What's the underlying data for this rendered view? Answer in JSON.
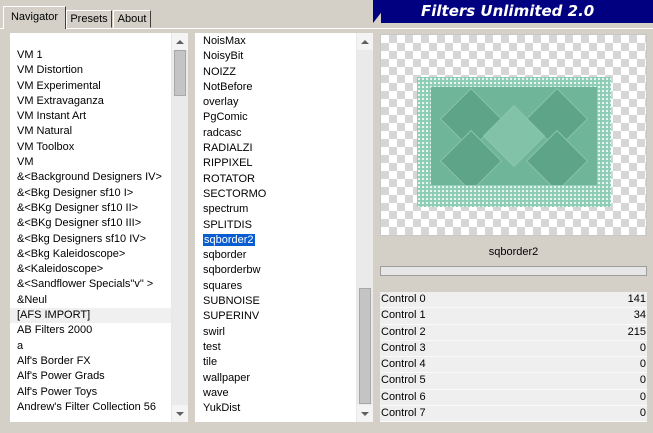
{
  "tabs": [
    {
      "label": "Navigator",
      "active": true
    },
    {
      "label": "Presets",
      "active": false
    },
    {
      "label": "About",
      "active": false
    }
  ],
  "banner": {
    "title": "Filters Unlimited 2.0",
    "color": "#000080"
  },
  "categories": {
    "items": [
      "VM 1",
      "VM Distortion",
      "VM Experimental",
      "VM Extravaganza",
      "VM Instant Art",
      "VM Natural",
      "VM Toolbox",
      "VM",
      "&<Background Designers IV>",
      "&<Bkg Designer sf10 I>",
      "&<BKg Designer sf10 II>",
      "&<BKg Designer sf10 III>",
      "&<Bkg Designers sf10 IV>",
      "&<Bkg Kaleidoscope>",
      "&<Kaleidoscope>",
      "&<Sandflower Specials\"v\" >",
      "&Neul",
      "[AFS IMPORT]",
      "AB Filters 2000",
      "a",
      "Alf's Border FX",
      "Alf's Power Grads",
      "Alf's Power Toys",
      "Andrew's Filter Collection 56"
    ],
    "highlighted": "[AFS IMPORT]"
  },
  "filters": {
    "items": [
      "NoisMax",
      "NoisyBit",
      "NOIZZ",
      "NotBefore",
      "overlay",
      "PgComic",
      "radcasc",
      "RADIALZI",
      "RIPPIXEL",
      "ROTATOR",
      "SECTORMO",
      "spectrum",
      "SPLITDIS",
      "sqborder2",
      "sqborder",
      "sqborderbw",
      "squares",
      "SUBNOISE",
      "SUPERINV",
      "swirl",
      "test",
      "tile",
      "wallpaper",
      "wave",
      "YukDist"
    ],
    "selected": "sqborder2",
    "selection_color": "#0a5dd0"
  },
  "preview": {
    "filter_name": "sqborder2",
    "accent": "#6fb59a"
  },
  "controls": [
    {
      "label": "Control 0",
      "value": "141"
    },
    {
      "label": "Control 1",
      "value": "34"
    },
    {
      "label": "Control 2",
      "value": "215"
    },
    {
      "label": "Control 3",
      "value": "0"
    },
    {
      "label": "Control 4",
      "value": "0"
    },
    {
      "label": "Control 5",
      "value": "0"
    },
    {
      "label": "Control 6",
      "value": "0"
    },
    {
      "label": "Control 7",
      "value": "0"
    }
  ]
}
